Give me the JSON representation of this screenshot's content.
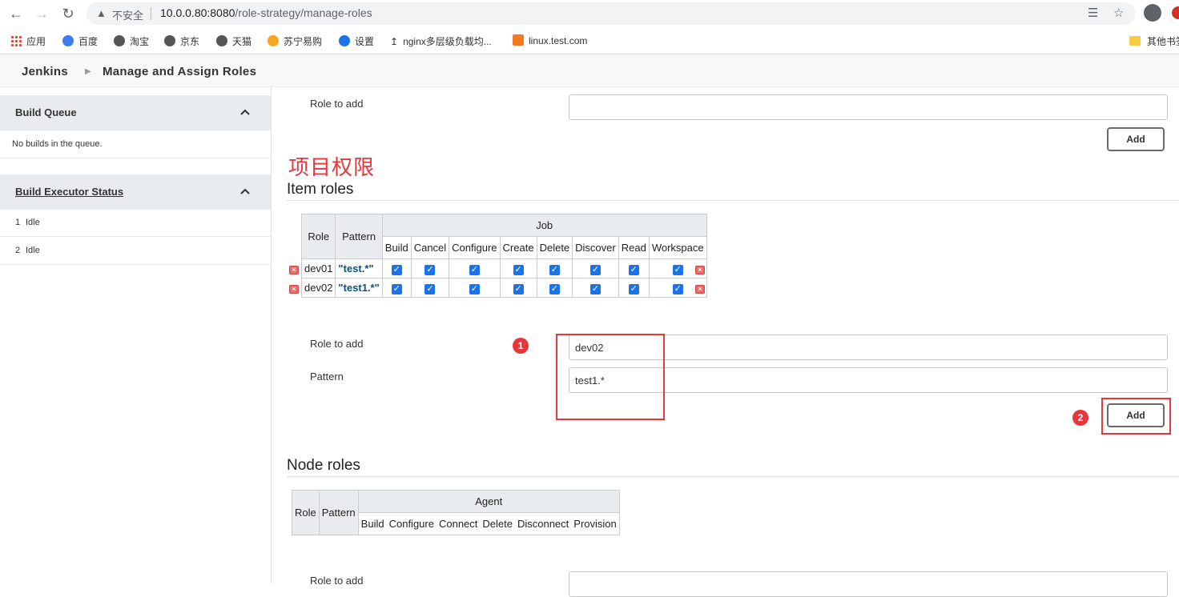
{
  "browser": {
    "insecure_label": "不安全",
    "url_host": "10.0.0.80:8080",
    "url_path": "/role-strategy/manage-roles",
    "bookmarks": [
      "应用",
      "百度",
      "淘宝",
      "京东",
      "天猫",
      "苏宁易购",
      "设置",
      "nginx多层级负载均...",
      "linux.test.com"
    ],
    "other_bookmarks": "其他书签"
  },
  "breadcrumb": {
    "home": "Jenkins",
    "current": "Manage and Assign Roles"
  },
  "sidebar": {
    "build_queue": {
      "title": "Build Queue",
      "empty_text": "No builds in the queue."
    },
    "executor_status": {
      "title": "Build Executor Status",
      "executors": [
        {
          "num": "1",
          "state": "Idle"
        },
        {
          "num": "2",
          "state": "Idle"
        }
      ]
    }
  },
  "global_role_add": {
    "label": "Role to add",
    "value": "",
    "add_label": "Add"
  },
  "annotation_title": "项目权限",
  "item_roles": {
    "title": "Item roles",
    "headers": {
      "role": "Role",
      "pattern": "Pattern",
      "group": "Job"
    },
    "permissions": [
      "Build",
      "Cancel",
      "Configure",
      "Create",
      "Delete",
      "Discover",
      "Read",
      "Workspace"
    ],
    "rows": [
      {
        "role": "dev01",
        "pattern": "\"test.*\"",
        "checked": [
          true,
          true,
          true,
          true,
          true,
          true,
          true,
          true
        ]
      },
      {
        "role": "dev02",
        "pattern": "\"test1.*\"",
        "checked": [
          true,
          true,
          true,
          true,
          true,
          true,
          true,
          true
        ]
      }
    ],
    "add_form": {
      "role_label": "Role to add",
      "role_value": "dev02",
      "pattern_label": "Pattern",
      "pattern_value": "test1.*",
      "add_label": "Add"
    },
    "annotations": [
      "1",
      "2"
    ]
  },
  "node_roles": {
    "title": "Node roles",
    "headers": {
      "role": "Role",
      "pattern": "Pattern",
      "group": "Agent"
    },
    "permissions": [
      "Build",
      "Configure",
      "Connect",
      "Delete",
      "Disconnect",
      "Provision"
    ],
    "add_label": "Role to add"
  },
  "colors": {
    "annotation_red": "#e8373b",
    "checkbox_blue": "#1a73e8",
    "pattern_text": "#0b4f7c"
  }
}
